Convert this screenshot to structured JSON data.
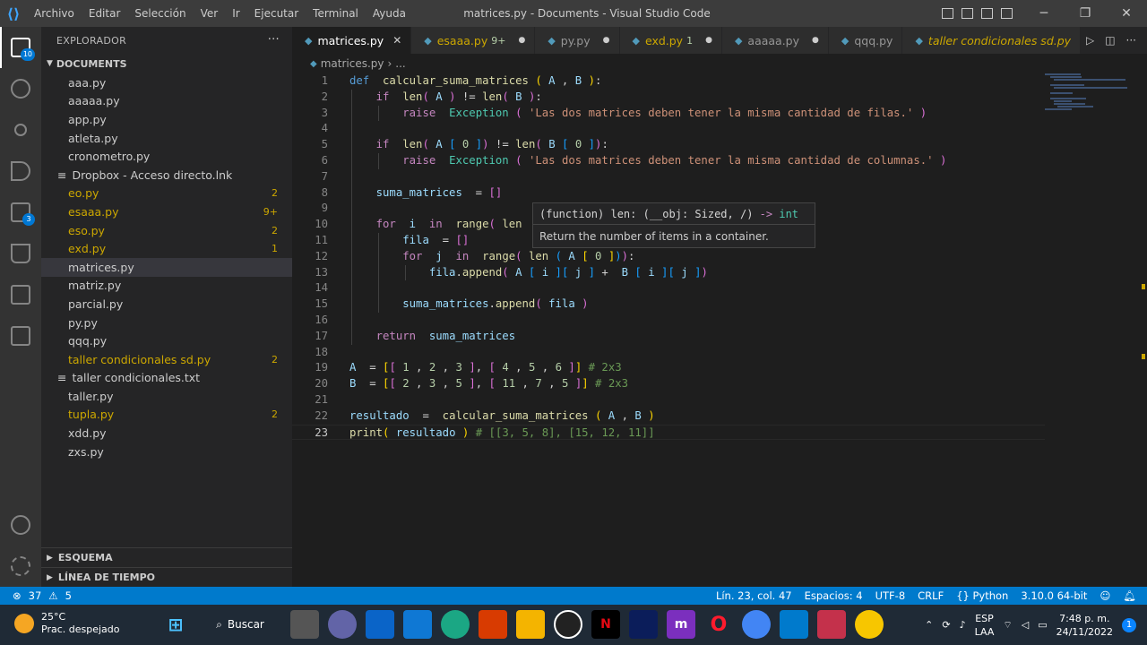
{
  "window": {
    "title": "matrices.py - Documents - Visual Studio Code",
    "menu": [
      "Archivo",
      "Editar",
      "Selección",
      "Ver",
      "Ir",
      "Ejecutar",
      "Terminal",
      "Ayuda"
    ]
  },
  "activity": {
    "explorer_badge": "10",
    "extensions_badge": "3"
  },
  "sidebar": {
    "header": "EXPLORADOR",
    "folder": "DOCUMENTS",
    "files": [
      {
        "name": "aaa.py",
        "count": ""
      },
      {
        "name": "aaaaa.py",
        "count": ""
      },
      {
        "name": "app.py",
        "count": ""
      },
      {
        "name": "atleta.py",
        "count": ""
      },
      {
        "name": "cronometro.py",
        "count": ""
      },
      {
        "name": "Dropbox - Acceso directo.lnk",
        "count": ""
      },
      {
        "name": "eo.py",
        "count": "2"
      },
      {
        "name": "esaaa.py",
        "count": "9+"
      },
      {
        "name": "eso.py",
        "count": "2"
      },
      {
        "name": "exd.py",
        "count": "1"
      },
      {
        "name": "matrices.py",
        "count": ""
      },
      {
        "name": "matriz.py",
        "count": ""
      },
      {
        "name": "parcial.py",
        "count": ""
      },
      {
        "name": "py.py",
        "count": ""
      },
      {
        "name": "qqq.py",
        "count": ""
      },
      {
        "name": "taller condicionales sd.py",
        "count": "2"
      },
      {
        "name": "taller condicionales.txt",
        "count": ""
      },
      {
        "name": "taller.py",
        "count": ""
      },
      {
        "name": "tupla.py",
        "count": "2"
      },
      {
        "name": "xdd.py",
        "count": ""
      },
      {
        "name": "zxs.py",
        "count": ""
      }
    ],
    "outline": "ESQUEMA",
    "timeline": "LÍNEA DE TIEMPO"
  },
  "tabs": [
    {
      "label": "matrices.py",
      "num": ""
    },
    {
      "label": "esaaa.py",
      "num": "9+"
    },
    {
      "label": "py.py",
      "num": ""
    },
    {
      "label": "exd.py",
      "num": "1"
    },
    {
      "label": "aaaaa.py",
      "num": ""
    },
    {
      "label": "qqq.py",
      "num": ""
    },
    {
      "label": "taller condicionales sd.py",
      "num": ""
    }
  ],
  "breadcrumb": {
    "file": "matrices.py",
    "rest": "..."
  },
  "hover": {
    "signature_start": "(function) len: (__obj: Sized, /)",
    "arrow": "->",
    "return_type": "int",
    "doc": "Return the number of items in a container."
  },
  "status": {
    "errors": "37",
    "warnings": "5",
    "position": "Lín. 23, col. 47",
    "spaces": "Espacios: 4",
    "encoding": "UTF-8",
    "eol": "CRLF",
    "language": "Python",
    "interpreter": "3.10.0 64-bit"
  },
  "taskbar": {
    "temp": "25°C",
    "weather": "Prac. despejado",
    "search": "Buscar",
    "lang1": "ESP",
    "lang2": "LAA",
    "time": "7:48 p. m.",
    "date": "24/11/2022",
    "notifications": "1"
  }
}
